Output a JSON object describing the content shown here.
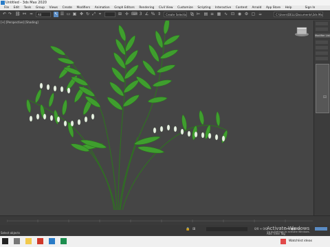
{
  "window": {
    "title": "Untitled - 3ds Max 2020"
  },
  "menu": {
    "items": [
      "File",
      "Edit",
      "Tools",
      "Group",
      "Views",
      "Create",
      "Modifiers",
      "Animation",
      "Graph Editors",
      "Rendering",
      "Civil View",
      "Customize",
      "Scripting",
      "Interactive",
      "Content",
      "Arnold",
      "App Store",
      "Help"
    ],
    "sign_in": "Sign In"
  },
  "toolbar": {
    "selection_filter": "All",
    "snaps_set": "Create Selection Se",
    "workspace_path": "C:\\Users\\DELL\\Documents\\3ds Max 2020"
  },
  "viewport": {
    "label": "[+] [Perspective] [Shading]"
  },
  "right_panel": {
    "modifier_list": "Modifier List"
  },
  "status": {
    "selection": "Select objects",
    "coords": "0/0 + 0/0",
    "add_time_tag": "Add Time Tag"
  },
  "activation": {
    "line1": "Activate Windows",
    "line2": "Go to Settings to activate Windows."
  },
  "taskbar": {
    "weather": "Watchlist ideas"
  },
  "colors": {
    "accent": "#5a8cc4",
    "leaf": "#3f9e2e",
    "flower": "#e8f0e4"
  }
}
